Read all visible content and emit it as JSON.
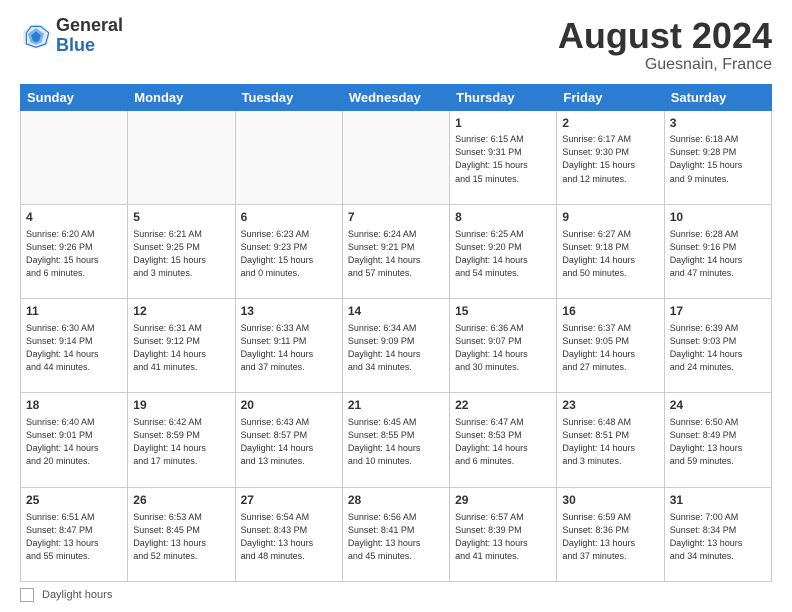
{
  "header": {
    "logo_general": "General",
    "logo_blue": "Blue",
    "month_title": "August 2024",
    "subtitle": "Guesnain, France"
  },
  "footer": {
    "daylight_label": "Daylight hours"
  },
  "weekdays": [
    "Sunday",
    "Monday",
    "Tuesday",
    "Wednesday",
    "Thursday",
    "Friday",
    "Saturday"
  ],
  "weeks": [
    [
      {
        "day": "",
        "info": ""
      },
      {
        "day": "",
        "info": ""
      },
      {
        "day": "",
        "info": ""
      },
      {
        "day": "",
        "info": ""
      },
      {
        "day": "1",
        "info": "Sunrise: 6:15 AM\nSunset: 9:31 PM\nDaylight: 15 hours\nand 15 minutes."
      },
      {
        "day": "2",
        "info": "Sunrise: 6:17 AM\nSunset: 9:30 PM\nDaylight: 15 hours\nand 12 minutes."
      },
      {
        "day": "3",
        "info": "Sunrise: 6:18 AM\nSunset: 9:28 PM\nDaylight: 15 hours\nand 9 minutes."
      }
    ],
    [
      {
        "day": "4",
        "info": "Sunrise: 6:20 AM\nSunset: 9:26 PM\nDaylight: 15 hours\nand 6 minutes."
      },
      {
        "day": "5",
        "info": "Sunrise: 6:21 AM\nSunset: 9:25 PM\nDaylight: 15 hours\nand 3 minutes."
      },
      {
        "day": "6",
        "info": "Sunrise: 6:23 AM\nSunset: 9:23 PM\nDaylight: 15 hours\nand 0 minutes."
      },
      {
        "day": "7",
        "info": "Sunrise: 6:24 AM\nSunset: 9:21 PM\nDaylight: 14 hours\nand 57 minutes."
      },
      {
        "day": "8",
        "info": "Sunrise: 6:25 AM\nSunset: 9:20 PM\nDaylight: 14 hours\nand 54 minutes."
      },
      {
        "day": "9",
        "info": "Sunrise: 6:27 AM\nSunset: 9:18 PM\nDaylight: 14 hours\nand 50 minutes."
      },
      {
        "day": "10",
        "info": "Sunrise: 6:28 AM\nSunset: 9:16 PM\nDaylight: 14 hours\nand 47 minutes."
      }
    ],
    [
      {
        "day": "11",
        "info": "Sunrise: 6:30 AM\nSunset: 9:14 PM\nDaylight: 14 hours\nand 44 minutes."
      },
      {
        "day": "12",
        "info": "Sunrise: 6:31 AM\nSunset: 9:12 PM\nDaylight: 14 hours\nand 41 minutes."
      },
      {
        "day": "13",
        "info": "Sunrise: 6:33 AM\nSunset: 9:11 PM\nDaylight: 14 hours\nand 37 minutes."
      },
      {
        "day": "14",
        "info": "Sunrise: 6:34 AM\nSunset: 9:09 PM\nDaylight: 14 hours\nand 34 minutes."
      },
      {
        "day": "15",
        "info": "Sunrise: 6:36 AM\nSunset: 9:07 PM\nDaylight: 14 hours\nand 30 minutes."
      },
      {
        "day": "16",
        "info": "Sunrise: 6:37 AM\nSunset: 9:05 PM\nDaylight: 14 hours\nand 27 minutes."
      },
      {
        "day": "17",
        "info": "Sunrise: 6:39 AM\nSunset: 9:03 PM\nDaylight: 14 hours\nand 24 minutes."
      }
    ],
    [
      {
        "day": "18",
        "info": "Sunrise: 6:40 AM\nSunset: 9:01 PM\nDaylight: 14 hours\nand 20 minutes."
      },
      {
        "day": "19",
        "info": "Sunrise: 6:42 AM\nSunset: 8:59 PM\nDaylight: 14 hours\nand 17 minutes."
      },
      {
        "day": "20",
        "info": "Sunrise: 6:43 AM\nSunset: 8:57 PM\nDaylight: 14 hours\nand 13 minutes."
      },
      {
        "day": "21",
        "info": "Sunrise: 6:45 AM\nSunset: 8:55 PM\nDaylight: 14 hours\nand 10 minutes."
      },
      {
        "day": "22",
        "info": "Sunrise: 6:47 AM\nSunset: 8:53 PM\nDaylight: 14 hours\nand 6 minutes."
      },
      {
        "day": "23",
        "info": "Sunrise: 6:48 AM\nSunset: 8:51 PM\nDaylight: 14 hours\nand 3 minutes."
      },
      {
        "day": "24",
        "info": "Sunrise: 6:50 AM\nSunset: 8:49 PM\nDaylight: 13 hours\nand 59 minutes."
      }
    ],
    [
      {
        "day": "25",
        "info": "Sunrise: 6:51 AM\nSunset: 8:47 PM\nDaylight: 13 hours\nand 55 minutes."
      },
      {
        "day": "26",
        "info": "Sunrise: 6:53 AM\nSunset: 8:45 PM\nDaylight: 13 hours\nand 52 minutes."
      },
      {
        "day": "27",
        "info": "Sunrise: 6:54 AM\nSunset: 8:43 PM\nDaylight: 13 hours\nand 48 minutes."
      },
      {
        "day": "28",
        "info": "Sunrise: 6:56 AM\nSunset: 8:41 PM\nDaylight: 13 hours\nand 45 minutes."
      },
      {
        "day": "29",
        "info": "Sunrise: 6:57 AM\nSunset: 8:39 PM\nDaylight: 13 hours\nand 41 minutes."
      },
      {
        "day": "30",
        "info": "Sunrise: 6:59 AM\nSunset: 8:36 PM\nDaylight: 13 hours\nand 37 minutes."
      },
      {
        "day": "31",
        "info": "Sunrise: 7:00 AM\nSunset: 8:34 PM\nDaylight: 13 hours\nand 34 minutes."
      }
    ]
  ]
}
